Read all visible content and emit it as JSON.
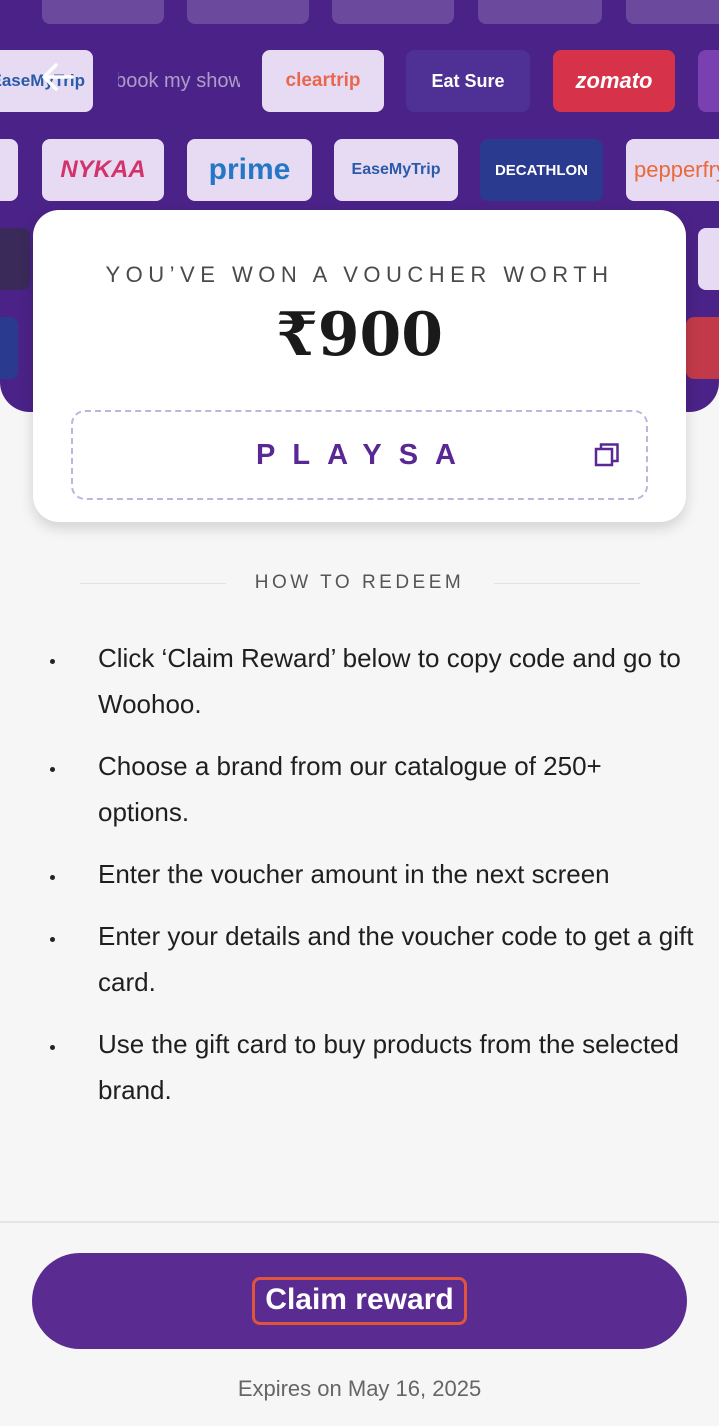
{
  "header": {
    "back_icon": "arrow-left-icon",
    "brands": [
      "EaseMyTrip",
      "book my show",
      "cleartrip",
      "Eat Sure",
      "zomato",
      "NYKAA",
      "prime",
      "DECATHLON",
      "pepperfry"
    ]
  },
  "voucher": {
    "title": "YOU’VE WON A VOUCHER WORTH",
    "amount": "₹900",
    "code": "PLAYSA",
    "copy_icon": "copy-icon"
  },
  "redeem": {
    "title": "HOW TO REDEEM",
    "steps": [
      "Click ‘Claim Reward’ below to copy code and go to Woohoo.",
      "Choose a brand from our catalogue of 250+ options.",
      "Enter the voucher amount in the next screen",
      "Enter your details and the voucher code to get a gift card.",
      "Use the gift card to buy products from the selected brand."
    ]
  },
  "footer": {
    "claim_label": "Claim reward",
    "expires": "Expires on May 16, 2025"
  },
  "colors": {
    "primary": "#5a2c91",
    "header_bg": "#4b2287",
    "highlight_outline": "#e0543c"
  }
}
